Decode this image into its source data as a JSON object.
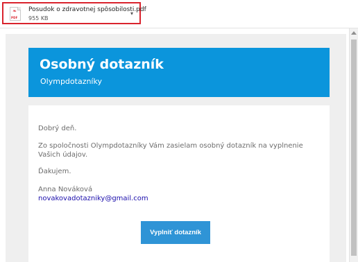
{
  "attachment": {
    "file_name": "Posudok o zdravotnej spôsobilosti.pdf",
    "file_size": "955 KB",
    "file_type": "PDF",
    "icon": "pdf-file-icon",
    "highlight_color": "#d9232d"
  },
  "email": {
    "header": {
      "title": "Osobný dotazník",
      "subtitle": "Olympdotazníky",
      "background_color": "#0b95dc"
    },
    "body": {
      "greeting": "Dobrý deň.",
      "message": "Zo spoločnosti Olympdotazníky Vám zasielam osobný dotazník na vyplnenie Vašich údajov.",
      "thanks": "Ďakujem.",
      "sender_name": "Anna Nováková",
      "sender_email": "novakovadotazniky@gmail.com"
    },
    "cta": {
      "label": "Vyplniť dotazník",
      "color": "#2f94d6"
    }
  }
}
